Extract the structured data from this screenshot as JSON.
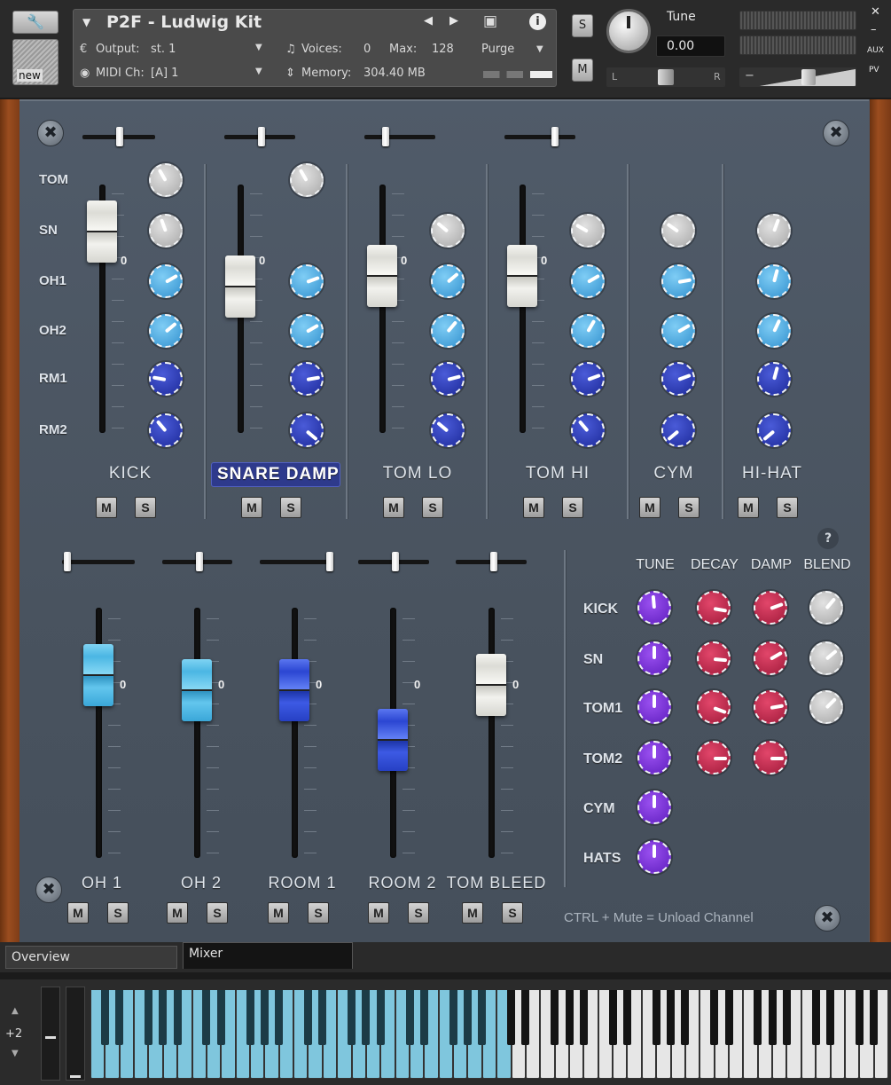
{
  "header": {
    "instrument_name": "P2F - Ludwig Kit",
    "output_label": "Output:",
    "output_value": "st. 1",
    "voices_label": "Voices:",
    "voices_value": "0",
    "max_label": "Max:",
    "max_value": "128",
    "purge_label": "Purge",
    "midi_label": "MIDI Ch:",
    "midi_value": "[A]  1",
    "memory_label": "Memory:",
    "memory_value": "304.40 MB",
    "new_label": "new",
    "solo_label": "S",
    "mute_label": "M",
    "tune_label": "Tune",
    "tune_value": "0.00",
    "pan_left": "L",
    "pan_right": "R",
    "aux_label": "AUX",
    "pv_label": "PV",
    "vol_minus": "−",
    "vol_plus": "+"
  },
  "mixer": {
    "row_labels": [
      "TOM",
      "SN",
      "OH1",
      "OH2",
      "RM1",
      "RM2"
    ],
    "top_channels": [
      {
        "label": "KICK",
        "selected": false,
        "fader": 0.9
      },
      {
        "label": "SNARE DAMP",
        "selected": true,
        "fader": 0.68
      },
      {
        "label": "TOM LO",
        "selected": false,
        "fader": 0.72
      },
      {
        "label": "TOM HI",
        "selected": false,
        "fader": 0.72
      },
      {
        "label": "CYM",
        "selected": false
      },
      {
        "label": "HI-HAT",
        "selected": false
      }
    ],
    "zero_label": "0",
    "mute_btn": "M",
    "solo_btn": "S",
    "bottom_channels": [
      {
        "label": "OH 1",
        "color": "cyan",
        "fader": 0.66
      },
      {
        "label": "OH 2",
        "color": "cyan",
        "fader": 0.6
      },
      {
        "label": "ROOM 1",
        "color": "blue",
        "fader": 0.6
      },
      {
        "label": "ROOM 2",
        "color": "blue",
        "fader": 0.4
      },
      {
        "label": "TOM BLEED",
        "color": "white",
        "fader": 0.62
      }
    ],
    "params": {
      "columns": [
        "TUNE",
        "DECAY",
        "DAMP",
        "BLEND"
      ],
      "rows": [
        "KICK",
        "SN",
        "TOM1",
        "TOM2",
        "CYM",
        "HATS"
      ],
      "help": "?"
    },
    "note": "CTRL + Mute = Unload Channel"
  },
  "tabs": [
    {
      "label": "Overview",
      "active": false
    },
    {
      "label": "Mixer",
      "active": true
    }
  ],
  "keyboard": {
    "transpose": "+2",
    "up": "▲",
    "down": "▼"
  },
  "colors": {
    "panel": "#4e5866",
    "knob_gray": "#bdbdbd",
    "knob_light_blue": "#4aa7e0",
    "knob_dark_blue": "#2b3bc0",
    "knob_purple": "#7a30dd",
    "knob_red": "#c22a52",
    "key_highlight": "#7fc6dd"
  }
}
